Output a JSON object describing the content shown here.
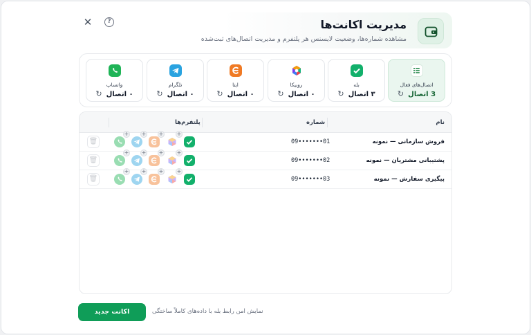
{
  "header": {
    "title": "مدیریت اکانت‌ها",
    "subtitle": "مشاهده شماره‌ها، وضعیت لایسنس هر پلتفرم و مدیریت اتصال‌های ثبت‌شده"
  },
  "cards": [
    {
      "key": "active",
      "label": "اتصال‌های فعال",
      "value": "3 اتصال",
      "icon": "list-icon"
    },
    {
      "key": "bale",
      "label": "بله",
      "value": "۳ اتصال",
      "icon": "bale-icon"
    },
    {
      "key": "rubika",
      "label": "روبیکا",
      "value": "۰ اتصال",
      "icon": "rubika-icon"
    },
    {
      "key": "eitaa",
      "label": "ایتا",
      "value": "۰ اتصال",
      "icon": "eitaa-icon"
    },
    {
      "key": "telegram",
      "label": "تلگرام",
      "value": "۰ اتصال",
      "icon": "telegram-icon"
    },
    {
      "key": "whatsapp",
      "label": "واتساپ",
      "value": "۰ اتصال",
      "icon": "whatsapp-icon"
    }
  ],
  "table": {
    "headers": {
      "name": "نام",
      "number": "شماره",
      "platforms": "پلتفرم‌ها"
    },
    "rows": [
      {
        "name": "فروش سازمانی — نمونه",
        "number": "09•••••••01"
      },
      {
        "name": "پشتیبانی مشتریان — نمونه",
        "number": "09•••••••02"
      },
      {
        "name": "پیگیری سفارش — نمونه",
        "number": "09•••••••03"
      }
    ]
  },
  "footer": {
    "new_account_label": "اکانت جدید",
    "note": "نمایش امن رابط بله با داده‌های کاملاً ساختگی"
  },
  "colors": {
    "accent": "#0f9d58",
    "bale": "#12b06b",
    "telegram": "#2aa3e0",
    "eitaa": "#f07a24",
    "whatsapp": "#1fb457"
  }
}
